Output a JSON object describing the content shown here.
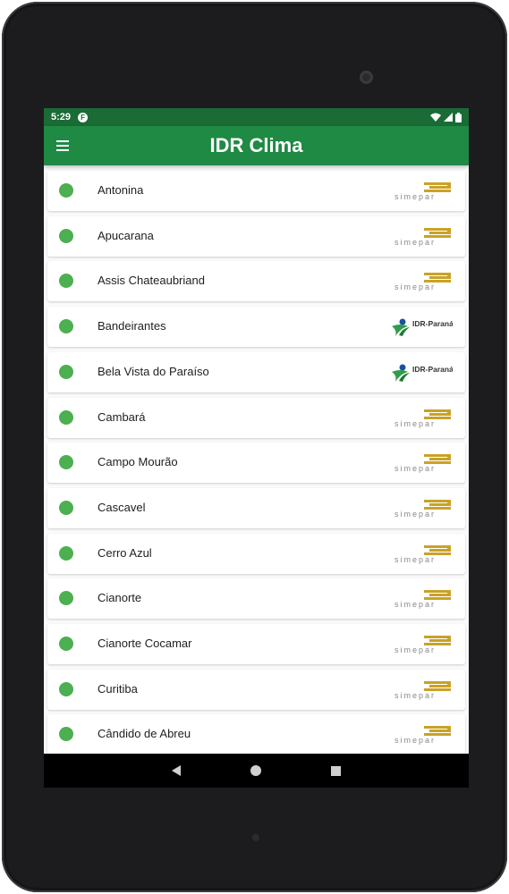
{
  "status_bar": {
    "time": "5:29",
    "app_icon": "flutter-icon"
  },
  "app_bar": {
    "title": "IDR Clima",
    "menu_icon": "hamburger-menu-icon"
  },
  "theme": {
    "primary": "#1f8a44",
    "status_bar": "#1a6b35",
    "status_dot": "#4caf50",
    "simepar_gold": "#c9a227",
    "idr_blue": "#1e4fa3"
  },
  "logos": {
    "simepar": "simepar",
    "idr": "IDR-Paraná"
  },
  "stations": [
    {
      "name": "Antonina",
      "logo": "simepar"
    },
    {
      "name": "Apucarana",
      "logo": "simepar"
    },
    {
      "name": "Assis Chateaubriand",
      "logo": "simepar"
    },
    {
      "name": "Bandeirantes",
      "logo": "idr"
    },
    {
      "name": "Bela Vista do Paraíso",
      "logo": "idr"
    },
    {
      "name": "Cambará",
      "logo": "simepar"
    },
    {
      "name": "Campo Mourão",
      "logo": "simepar"
    },
    {
      "name": "Cascavel",
      "logo": "simepar"
    },
    {
      "name": "Cerro Azul",
      "logo": "simepar"
    },
    {
      "name": "Cianorte",
      "logo": "simepar"
    },
    {
      "name": "Cianorte Cocamar",
      "logo": "simepar"
    },
    {
      "name": "Curitiba",
      "logo": "simepar"
    },
    {
      "name": "Cândido de Abreu",
      "logo": "simepar"
    }
  ],
  "nav_bar": {
    "back_icon": "back-triangle-icon",
    "home_icon": "home-circle-icon",
    "recents_icon": "recents-square-icon"
  }
}
